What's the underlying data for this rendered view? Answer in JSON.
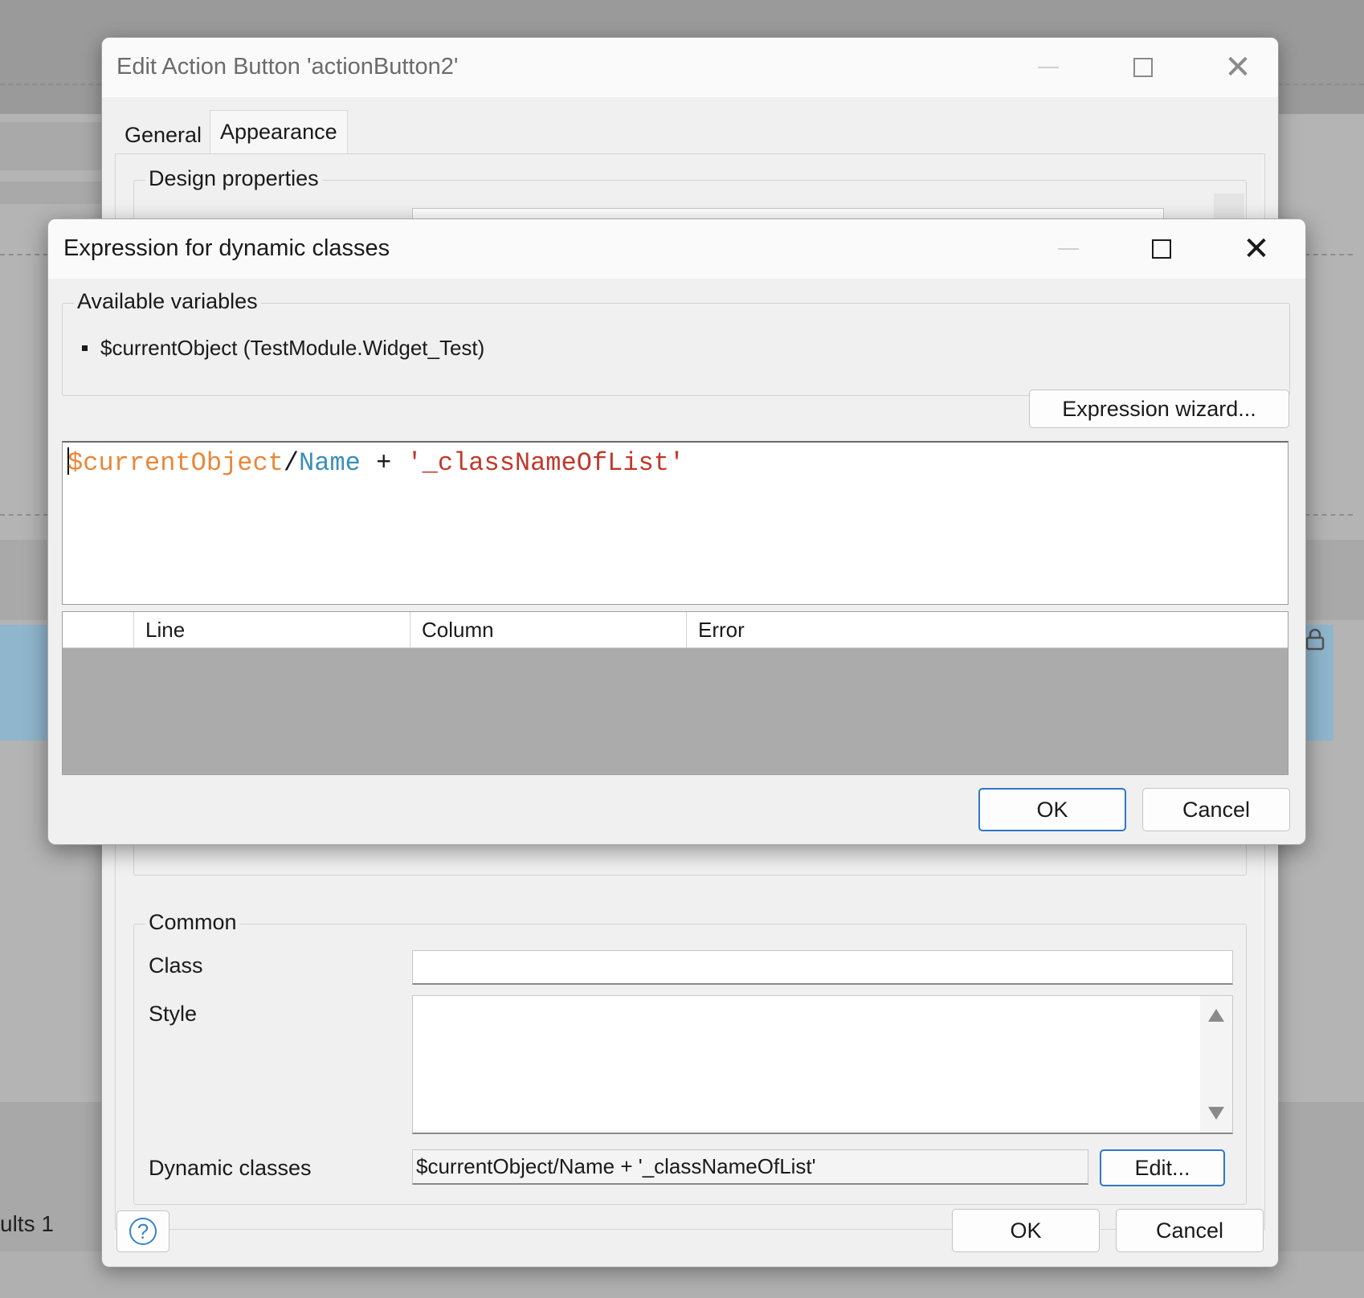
{
  "background": {
    "results_tab_label": "ults 1"
  },
  "edit_dialog": {
    "title": "Edit Action Button 'actionButton2'",
    "tabs": [
      {
        "label": "General",
        "active": false
      },
      {
        "label": "Appearance",
        "active": true
      }
    ],
    "design_properties": {
      "legend": "Design properties"
    },
    "common": {
      "legend": "Common",
      "class_label": "Class",
      "class_value": "",
      "style_label": "Style",
      "style_value": "",
      "dynamic_classes_label": "Dynamic classes",
      "dynamic_classes_value": "$currentObject/Name + '_classNameOfList'",
      "edit_button": "Edit..."
    },
    "ok_button": "OK",
    "cancel_button": "Cancel",
    "help_icon": "question-circle-icon"
  },
  "expression_dialog": {
    "title": "Expression for dynamic classes",
    "variables": {
      "legend": "Available variables",
      "items": [
        "$currentObject (TestModule.Widget_Test)"
      ]
    },
    "expression_wizard_button": "Expression wizard...",
    "expression": {
      "variable": "$currentObject",
      "separator": "/",
      "attribute": "Name",
      "operator": " + ",
      "string_literal": "'_classNameOfList'"
    },
    "colors": {
      "variable": "#e8883a",
      "attribute": "#3a8fb8",
      "operator": "#1a1a1a",
      "string": "#c0392b",
      "accent": "#2f77c4"
    },
    "error_grid": {
      "columns": [
        "Line",
        "Column",
        "Error"
      ],
      "rows": []
    },
    "ok_button": "OK",
    "cancel_button": "Cancel"
  }
}
